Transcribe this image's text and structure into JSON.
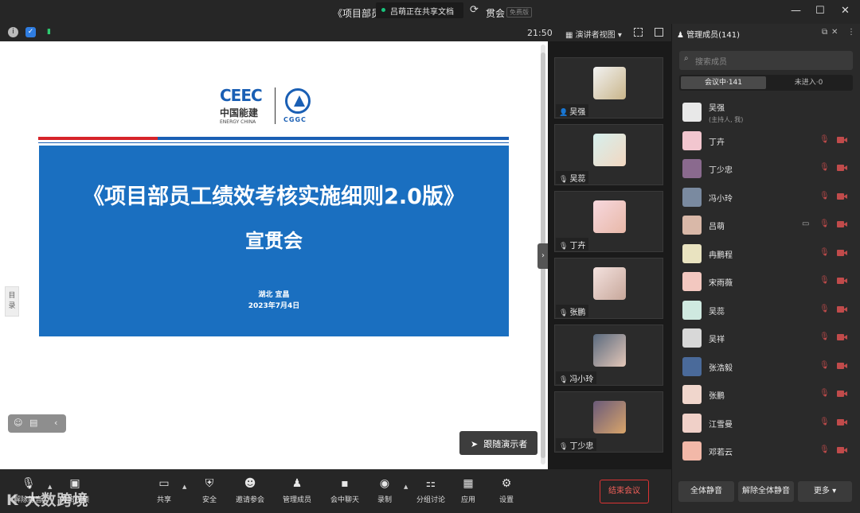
{
  "titlebar": {
    "title_left": "《项目部员",
    "sharing_status": "吕萌正在共享文档",
    "title_right": "贯会",
    "edition_badge": "免费版"
  },
  "infobar": {
    "time": "21:50",
    "view_mode": "演讲者视图"
  },
  "slide": {
    "logo_mark": "CEEC",
    "logo_cn": "中国能建",
    "logo_en": "ENERGY CHINA",
    "logo_right": "CGGC",
    "title_line1": "《项目部员工绩效考核实施细则2.0版》",
    "title_line2": "宣贯会",
    "location": "湖北  宜昌",
    "date": "2023年7月4日",
    "toc_label": "目录",
    "follow_presenter": "跟随演示者"
  },
  "video_tiles": [
    {
      "name": "吴强",
      "colors": [
        "#f2f2f2",
        "#c9b58a"
      ]
    },
    {
      "name": "吴蕊",
      "colors": [
        "#d6f0ee",
        "#f2d7c0"
      ]
    },
    {
      "name": "丁卉",
      "colors": [
        "#f7d8de",
        "#e8b8a8"
      ]
    },
    {
      "name": "张鹏",
      "colors": [
        "#f4e2df",
        "#c7a79a"
      ]
    },
    {
      "name": "冯小玲",
      "colors": [
        "#5a6a7e",
        "#e4c7b8"
      ]
    },
    {
      "name": "丁少忠",
      "colors": [
        "#6a5a7a",
        "#d9a56a"
      ]
    }
  ],
  "toolbar": {
    "items": [
      {
        "label": "解除静音",
        "icon": "mic-icon"
      },
      {
        "label": "开启视频",
        "icon": "video-icon"
      },
      {
        "label": "共享",
        "icon": "share-icon"
      },
      {
        "label": "安全",
        "icon": "shield-icon"
      },
      {
        "label": "邀请参会",
        "icon": "invite-icon"
      },
      {
        "label": "管理成员",
        "icon": "members-icon"
      },
      {
        "label": "会中聊天",
        "icon": "chat-icon"
      },
      {
        "label": "录制",
        "icon": "record-icon"
      },
      {
        "label": "分组讨论",
        "icon": "breakout-icon"
      },
      {
        "label": "应用",
        "icon": "apps-icon"
      },
      {
        "label": "设置",
        "icon": "settings-icon"
      }
    ],
    "end_meeting": "结束会议",
    "watermark": "K   大数跨境"
  },
  "panel": {
    "title": "管理成员(141)",
    "search_placeholder": "搜索成员",
    "tab_in_meeting": "会议中·141",
    "tab_not_joined": "未进入·0",
    "members": [
      {
        "name": "吴强",
        "sub": "(主持人, 我)",
        "color": "#e8e8e8",
        "host": true,
        "sharing": false
      },
      {
        "name": "丁卉",
        "sub": "",
        "color": "#f2c6cf",
        "host": false,
        "sharing": false
      },
      {
        "name": "丁少忠",
        "sub": "",
        "color": "#8a6a8e",
        "host": false,
        "sharing": false
      },
      {
        "name": "冯小玲",
        "sub": "",
        "color": "#7a8aa0",
        "host": false,
        "sharing": false
      },
      {
        "name": "吕萌",
        "sub": "",
        "color": "#d9b8a8",
        "host": false,
        "sharing": true
      },
      {
        "name": "冉鹏程",
        "sub": "",
        "color": "#e9e3c0",
        "host": false,
        "sharing": false
      },
      {
        "name": "宋雨薇",
        "sub": "",
        "color": "#f3c8c0",
        "host": false,
        "sharing": false
      },
      {
        "name": "吴蕊",
        "sub": "",
        "color": "#cfe9e0",
        "host": false,
        "sharing": false
      },
      {
        "name": "吴祥",
        "sub": "",
        "color": "#d8d8d8",
        "host": false,
        "sharing": false
      },
      {
        "name": "张浩毅",
        "sub": "",
        "color": "#4a6a9a",
        "host": false,
        "sharing": false
      },
      {
        "name": "张鹏",
        "sub": "",
        "color": "#f0d6cc",
        "host": false,
        "sharing": false
      },
      {
        "name": "江雪曼",
        "sub": "",
        "color": "#f0d0c8",
        "host": false,
        "sharing": false
      },
      {
        "name": "邓若云",
        "sub": "",
        "color": "#f2b8a8",
        "host": false,
        "sharing": false
      }
    ],
    "mute_all": "全体静音",
    "unmute_all": "解除全体静音",
    "more": "更多"
  }
}
